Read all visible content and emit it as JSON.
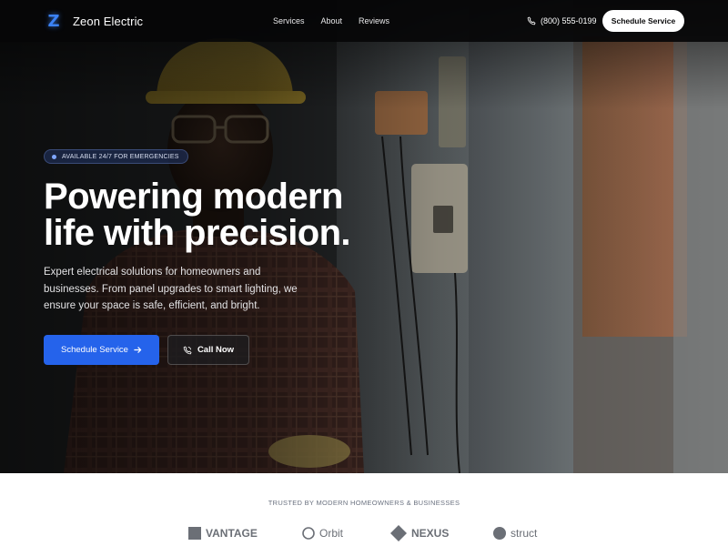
{
  "brand": {
    "logo_letter": "Z",
    "name": "Zeon Electric",
    "accent": "#2563eb"
  },
  "nav": {
    "links": [
      "Services",
      "About",
      "Reviews"
    ],
    "phone": "(800) 555-0199",
    "cta_label": "Schedule Service"
  },
  "hero": {
    "badge": "AVAILABLE 24/7 FOR EMERGENCIES",
    "headline_line1": "Powering modern",
    "headline_line2": "life with precision.",
    "subtext": "Expert electrical solutions for homeowners and businesses. From panel upgrades to smart lighting, we ensure your space is safe, efficient, and bright.",
    "primary_button": "Schedule Service",
    "primary_icon": "arrow-right-icon",
    "secondary_button": "Call Now",
    "secondary_icon": "phone-icon"
  },
  "trusted": {
    "label": "TRUSTED BY MODERN HOMEOWNERS & BUSINESSES",
    "logos": [
      {
        "name": "VANTAGE",
        "icon": "square-icon"
      },
      {
        "name": "Orbit",
        "icon": "circle-outline-icon"
      },
      {
        "name": "NEXUS",
        "icon": "diamond-icon"
      },
      {
        "name": "struct",
        "icon": "circle-filled-icon"
      }
    ]
  }
}
